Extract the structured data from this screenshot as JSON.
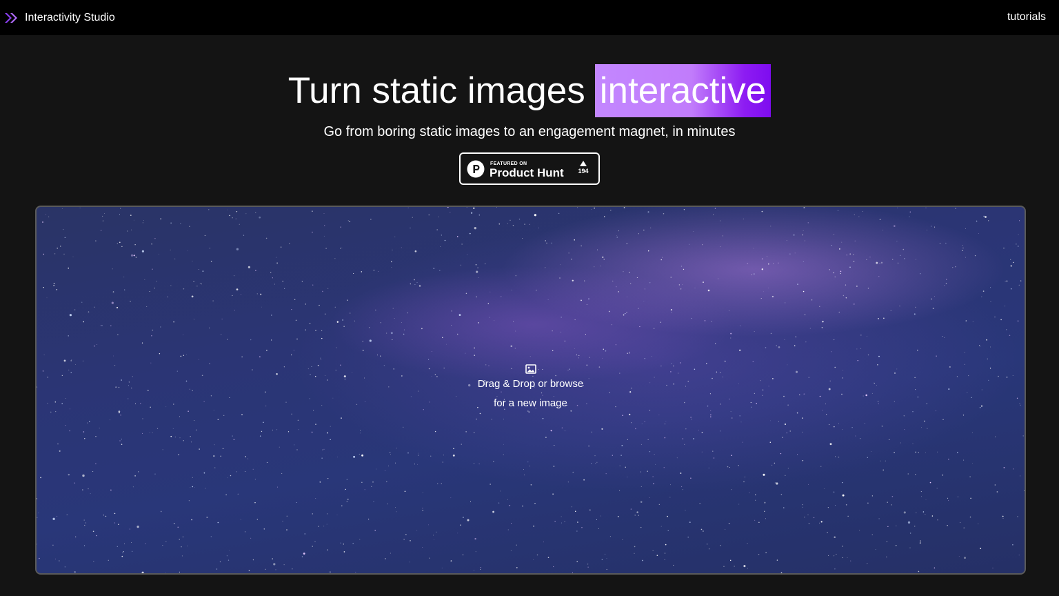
{
  "header": {
    "brand_name": "Interactivity Studio",
    "brand_icon": "double-chevron-right-icon",
    "nav_link": "tutorials"
  },
  "hero": {
    "headline_plain": "Turn static images",
    "headline_highlight": "interactive",
    "subheadline": "Go from boring static images to an engagement magnet, in minutes",
    "highlight_colors": [
      "#c387ff",
      "#7e0cf0"
    ]
  },
  "product_hunt_badge": {
    "featured_label": "FEATURED ON",
    "name": "Product Hunt",
    "upvotes": "194",
    "logo_icon": "product-hunt-logo-icon",
    "upvote_icon": "triangle-up-icon"
  },
  "dropzone": {
    "icon": "image-icon",
    "line1": "Drag & Drop or browse",
    "line2": "for a new image"
  }
}
